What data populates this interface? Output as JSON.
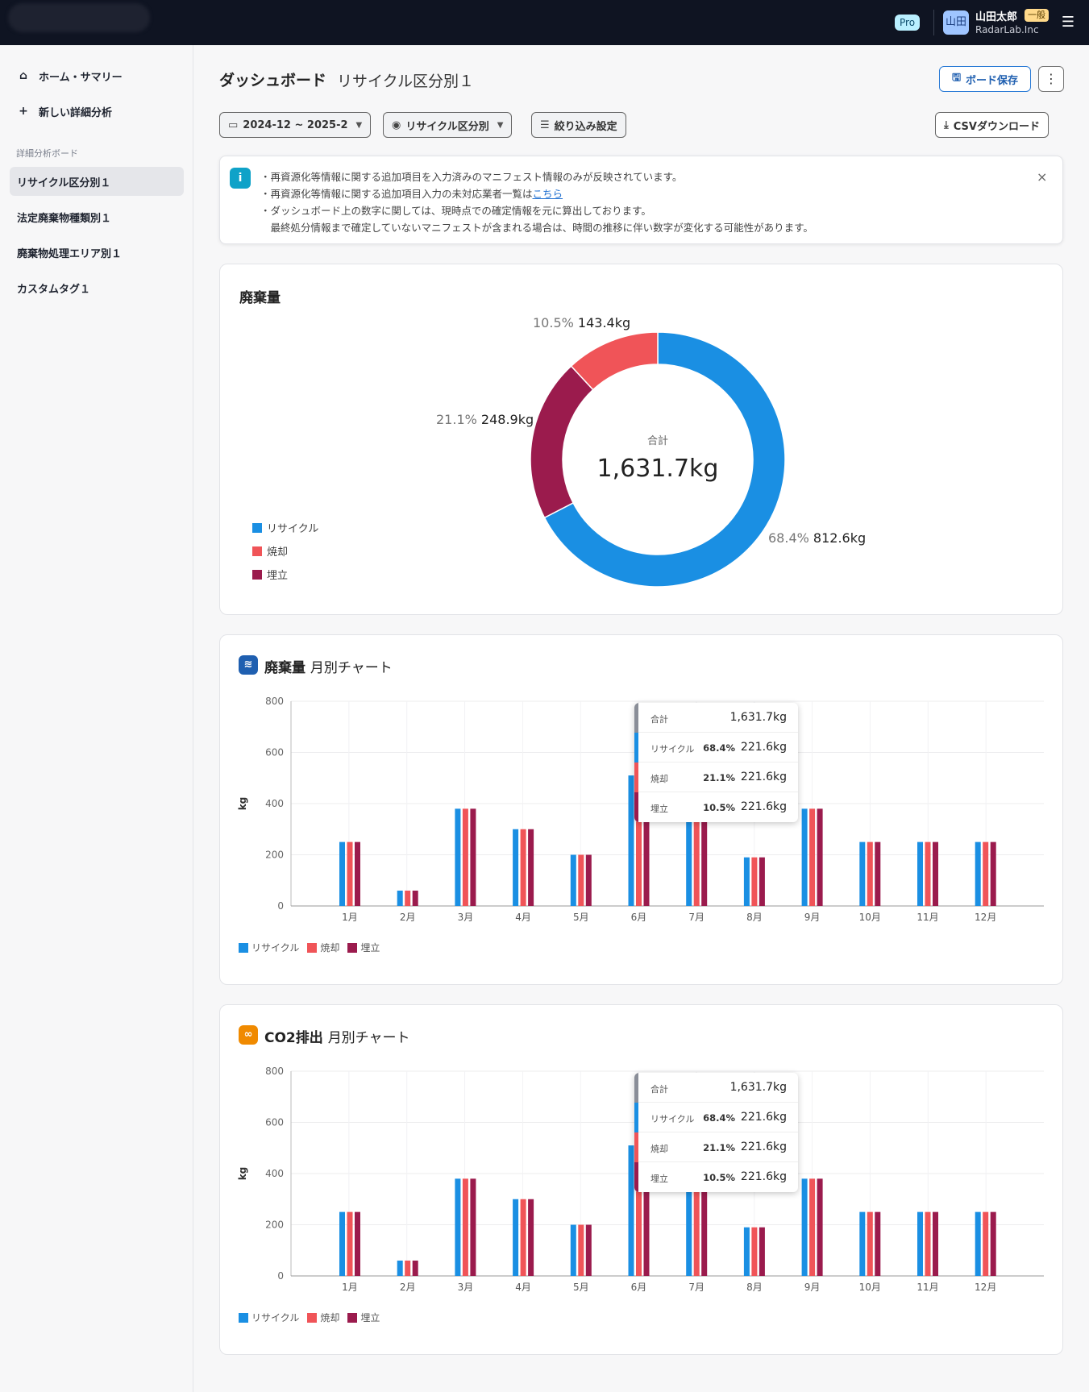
{
  "header": {
    "pro_label": "Pro",
    "avatar_text": "山田",
    "user_name": "山田太郎",
    "user_role": "一般",
    "user_org": "RadarLab.Inc"
  },
  "sidebar": {
    "home_label": "ホーム・サマリー",
    "new_analysis_label": "新しい詳細分析",
    "section_label": "詳細分析ボード",
    "boards": [
      "リサイクル区分別１",
      "法定廃棄物種類別１",
      "廃棄物処理エリア別１",
      "カスタムタグ１"
    ]
  },
  "page": {
    "title": "ダッシュボード",
    "subtitle": "リサイクル区分別１",
    "save_button": "ボード保存",
    "more_button": "⋮",
    "filters": {
      "date_range": "2024-12 ~ 2025-2",
      "view": "リサイクル区分別",
      "narrow": "絞り込み設定"
    },
    "csv_button": "CSVダウンロード"
  },
  "notice": {
    "lines": [
      "・再資源化等情報に関する追加項目を入力済みのマニフェスト情報のみが反映されています。",
      "・再資源化等情報に関する追加項目入力の未対応業者一覧は",
      "・ダッシュボード上の数字に関しては、現時点での確定情報を元に算出しております。",
      "　最終処分情報まで確定していないマニフェストが含まれる場合は、時間の推移に伴い数字が変化する可能性があります。"
    ],
    "link_text": "こちら",
    "close": "×"
  },
  "colors": {
    "recycle": "#1a8fe3",
    "incinerate": "#f05458",
    "landfill": "#9b1b4d"
  },
  "legend": [
    "リサイクル",
    "焼却",
    "埋立"
  ],
  "donut_card": {
    "title": "廃棄量",
    "center_label": "合計",
    "center_value": "1,631.7kg",
    "labels": {
      "recycle": {
        "pct": "68.4%",
        "val": "812.6kg"
      },
      "landfill": {
        "pct": "21.1%",
        "val": "248.9kg"
      },
      "incinerate": {
        "pct": "10.5%",
        "val": "143.4kg"
      }
    }
  },
  "waste_card": {
    "title_bold": "廃棄量",
    "title_thin": "月別チャート"
  },
  "co2_card": {
    "title_bold": "CO2排出",
    "title_thin": "月別チャート"
  },
  "tooltip": {
    "total_label": "合計",
    "total_value": "1,631.7kg",
    "rows": [
      {
        "label": "リサイクル",
        "pct": "68.4%",
        "value": "221.6kg"
      },
      {
        "label": "焼却",
        "pct": "21.1%",
        "value": "221.6kg"
      },
      {
        "label": "埋立",
        "pct": "10.5%",
        "value": "221.6kg"
      }
    ]
  },
  "chart_data": [
    {
      "type": "pie",
      "title": "廃棄量",
      "categories": [
        "リサイクル",
        "埋立",
        "焼却"
      ],
      "values": [
        812.6,
        248.9,
        143.4
      ],
      "percentages": [
        68.4,
        21.1,
        10.5
      ]
    },
    {
      "type": "bar",
      "title": "廃棄量 月別チャート",
      "ylabel": "kg",
      "ylim": [
        0,
        800
      ],
      "yticks": [
        0,
        200,
        400,
        600,
        800
      ],
      "categories": [
        "1月",
        "2月",
        "3月",
        "4月",
        "5月",
        "6月",
        "7月",
        "8月",
        "9月",
        "10月",
        "11月",
        "12月"
      ],
      "series": [
        {
          "name": "リサイクル",
          "values": [
            250,
            60,
            380,
            300,
            200,
            510,
            330,
            190,
            380,
            250,
            250,
            250
          ]
        },
        {
          "name": "焼却",
          "values": [
            250,
            60,
            380,
            300,
            200,
            330,
            330,
            190,
            380,
            250,
            250,
            250
          ]
        },
        {
          "name": "埋立",
          "values": [
            250,
            60,
            380,
            300,
            200,
            330,
            330,
            190,
            380,
            250,
            250,
            250
          ]
        }
      ]
    },
    {
      "type": "bar",
      "title": "CO2排出 月別チャート",
      "ylabel": "kg",
      "ylim": [
        0,
        800
      ],
      "yticks": [
        0,
        200,
        400,
        600,
        800
      ],
      "categories": [
        "1月",
        "2月",
        "3月",
        "4月",
        "5月",
        "6月",
        "7月",
        "8月",
        "9月",
        "10月",
        "11月",
        "12月"
      ],
      "series": [
        {
          "name": "リサイクル",
          "values": [
            250,
            60,
            380,
            300,
            200,
            510,
            330,
            190,
            380,
            250,
            250,
            250
          ]
        },
        {
          "name": "焼却",
          "values": [
            250,
            60,
            380,
            300,
            200,
            330,
            330,
            190,
            380,
            250,
            250,
            250
          ]
        },
        {
          "name": "埋立",
          "values": [
            250,
            60,
            380,
            300,
            200,
            330,
            330,
            190,
            380,
            250,
            250,
            250
          ]
        }
      ]
    }
  ]
}
